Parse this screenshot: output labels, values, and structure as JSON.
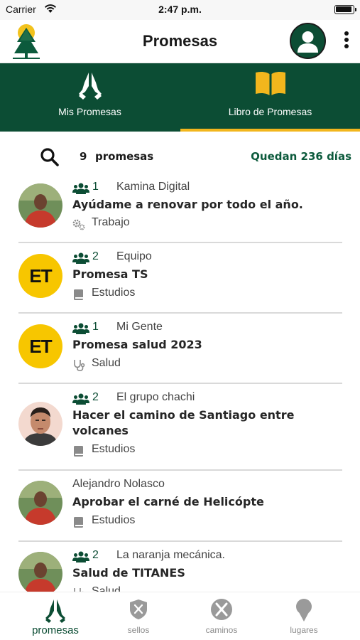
{
  "status_bar": {
    "carrier": "Carrier",
    "time": "2:47 p.m."
  },
  "header": {
    "title": "Promesas",
    "logo_icon": "tree-logo-icon",
    "avatar_icon": "user-avatar-icon",
    "menu_icon": "more-vertical-icon"
  },
  "tabs": [
    {
      "label": "Mis Promesas",
      "icon": "praying-hands-icon",
      "active": false
    },
    {
      "label": "Libro de Promesas",
      "icon": "open-book-icon",
      "active": true
    }
  ],
  "toolbar": {
    "search_icon": "search-icon",
    "count": "9",
    "count_label": "promesas",
    "days_remaining": "Quedan 236 días"
  },
  "promises": [
    {
      "members": "1",
      "group": "Kamina Digital",
      "owner": "",
      "title": "Ayúdame a renovar por todo el año.",
      "category": "Trabajo",
      "category_icon": "gears-icon",
      "avatar": "photo-man-red-shirt"
    },
    {
      "members": "2",
      "group": "Equipo",
      "owner": "",
      "title": "Promesa TS",
      "category": "Estudios",
      "category_icon": "book-icon",
      "avatar": "ET"
    },
    {
      "members": "1",
      "group": "Mi Gente",
      "owner": "",
      "title": "Promesa salud 2023",
      "category": "Salud",
      "category_icon": "stethoscope-icon",
      "avatar": "ET"
    },
    {
      "members": "2",
      "group": "El grupo chachi",
      "owner": "",
      "title": "Hacer el camino de Santiago entre volcanes",
      "category": "Estudios",
      "category_icon": "book-icon",
      "avatar": "photo-man-portrait"
    },
    {
      "members": "",
      "group": "",
      "owner": "Alejandro Nolasco",
      "title": "Aprobar el carné de Helicópte",
      "category": "Estudios",
      "category_icon": "book-icon",
      "avatar": "photo-man-red-shirt"
    },
    {
      "members": "2",
      "group": "La naranja mecánica.",
      "owner": "",
      "title": "Salud de TITANES",
      "category": "Salud",
      "category_icon": "stethoscope-icon",
      "avatar": "photo-man-red-shirt"
    }
  ],
  "bottom_nav": [
    {
      "label": "promesas",
      "icon": "praying-hands-icon",
      "active": true
    },
    {
      "label": "sellos",
      "icon": "shield-tools-icon",
      "active": false
    },
    {
      "label": "caminos",
      "icon": "crossed-tools-icon",
      "active": false
    },
    {
      "label": "lugares",
      "icon": "map-pin-icon",
      "active": false
    }
  ],
  "colors": {
    "primary_green": "#0c4d34",
    "accent_yellow": "#f2b61d",
    "avatar_yellow": "#f7c600",
    "days_green": "#0c5a3c"
  }
}
